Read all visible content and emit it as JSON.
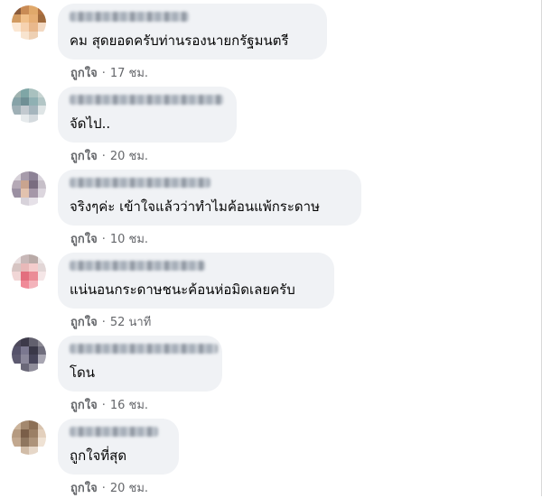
{
  "comments": [
    {
      "text": "คม สุดยอดครับท่านรองนายกรัฐมนตรี",
      "like": "ถูกใจ",
      "time": "17 ชม.",
      "avatar": [
        "#8a5a3a",
        "#c98b55",
        "#e0a86a",
        "#b07040",
        "#d19a60",
        "#f1c08a",
        "#e6ae74",
        "#a06a3c",
        "#fbe7d3",
        "#f6d2b0",
        "#e9b88c",
        "#f3d9c2",
        "#ffffff",
        "#f8e4cf",
        "#eed0b3",
        "#ffffff"
      ]
    },
    {
      "text": "จัดไป..",
      "like": "ถูกใจ",
      "time": "20 ชม.",
      "avatar": [
        "#9fb3b0",
        "#7fa6a6",
        "#a9c1bf",
        "#c7d4d2",
        "#87a3a8",
        "#6f8f95",
        "#8fb0b3",
        "#b3c6c6",
        "#9fb0b6",
        "#c2c9cf",
        "#a5b5bd",
        "#dfe5e6",
        "#ffffff",
        "#e6eaec",
        "#d4dade",
        "#ffffff"
      ]
    },
    {
      "text": "จริงๆค่ะ เข้าใจแล้วว่าทำไมค้อนแพ้กระดาษ",
      "like": "ถูกใจ",
      "time": "10 ชม.",
      "avatar": [
        "#d6d0d8",
        "#a79cab",
        "#8d8296",
        "#d9d4dc",
        "#b5a9b6",
        "#c9a48f",
        "#7a6d80",
        "#c6bfc8",
        "#9b90a2",
        "#e2c2ae",
        "#a597a8",
        "#dcd6de",
        "#ffffff",
        "#d7d2da",
        "#e6e1e8",
        "#ffffff"
      ]
    },
    {
      "text": "แน่นอนกระดาษชนะค้อนห่อมิดเลยครับ",
      "like": "ถูกใจ",
      "time": "52 นาที",
      "avatar": [
        "#e9dfe0",
        "#c8b8b8",
        "#b9aaa7",
        "#ece6e6",
        "#d7c5c3",
        "#e8b9b9",
        "#f4cccc",
        "#e2d6d6",
        "#f1d6d6",
        "#e36f7e",
        "#eb8c96",
        "#f5e6e7",
        "#ffffff",
        "#f08a98",
        "#f3b3bb",
        "#ffffff"
      ]
    },
    {
      "text": "โดน",
      "like": "ถูกใจ",
      "time": "16 ชม.",
      "avatar": [
        "#4e4a5c",
        "#3d3a4a",
        "#62606e",
        "#8c8a94",
        "#55526a",
        "#7b7890",
        "#3a3848",
        "#6f6d7c",
        "#5d5a70",
        "#8a879a",
        "#47455a",
        "#a8a6b2",
        "#ffffff",
        "#6a6878",
        "#8f8d9a",
        "#ffffff"
      ]
    },
    {
      "text": "ถูกใจที่สุด",
      "like": "ถูกใจ",
      "time": "20 ชม.",
      "avatar": [
        "#cbb39b",
        "#a3886e",
        "#8c6f55",
        "#d8c3ae",
        "#b59a80",
        "#7a5e48",
        "#9b7f65",
        "#e3d0bd",
        "#c2a88f",
        "#8f765f",
        "#ad937a",
        "#efe2d4",
        "#ffffff",
        "#d1bca7",
        "#e6d7c8",
        "#ffffff"
      ]
    }
  ]
}
